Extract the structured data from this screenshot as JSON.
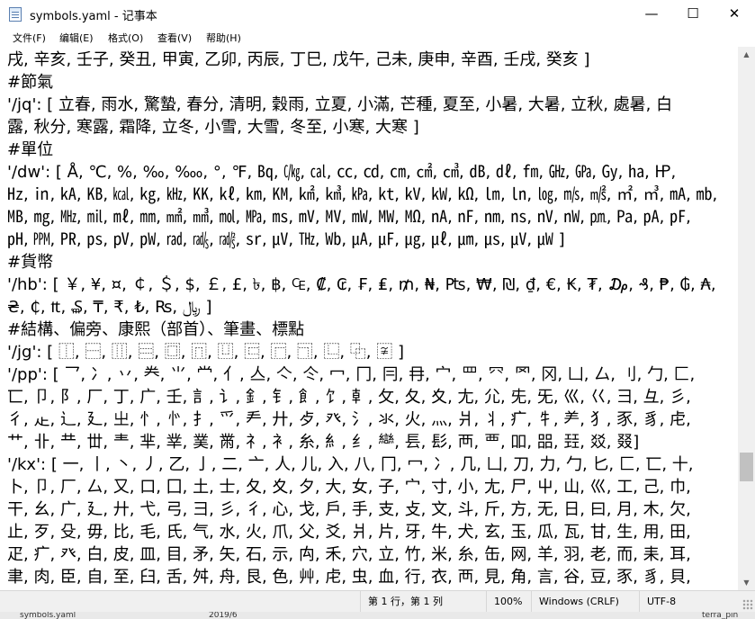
{
  "window": {
    "title": "symbols.yaml - 记事本",
    "minimize_glyph": "—",
    "maximize_glyph": "☐",
    "close_glyph": "✕",
    "icon": "notepad-icon"
  },
  "menu": {
    "items": [
      "文件(F)",
      "编辑(E)",
      "格式(O)",
      "查看(V)",
      "帮助(H)"
    ]
  },
  "editor": {
    "lines": [
      "戌, 辛亥, 壬子, 癸丑, 甲寅, 乙卯, 丙辰, 丁巳, 戊午, 己未, 庚申, 辛酉, 壬戌, 癸亥 ]",
      "#節氣",
      "   '/jq': [ 立春, 雨水, 驚蟄, 春分, 清明, 穀雨, 立夏, 小滿, 芒種, 夏至, 小暑, 大暑, 立秋, 處暑, 白",
      "露, 秋分, 寒露, 霜降, 立冬, 小雪, 大雪, 冬至, 小寒, 大寒 ]",
      "#單位",
      "   '/dw': [ Å, ℃, %, ‰, ‱, °, ℉, ㏃, ㏆, ㎈, ㏄, ㏅, ㎝, ㎠, ㎤, ㏈, ㎗, ㎙, ㎓, ㎬, ㏉, ㏊, ㏋,",
      "㎐, ㏌, ㎄, ㎅, ㎉, ㎏, ㎑, ㏍, ㎘, ㎞, ㏎, ㎢, ㎦, ㎪, ㏏, ㎸, ㎾, ㏀, ㏐, ㏑, ㏒, ㎧, ㎨, ㎡, ㎥, ㎃, ㏔,",
      "㎆, ㎎, ㎒, ㏕, ㎖, ㎜, ㎟, ㎣, ㏖, ㎫, ㎳, ㎷, ㎹, ㎽, ㎿, ㏁, ㎁, ㎋, ㎚, ㎱, ㎵, ㎻, ㏘, ㎩, ㎀, ㎊,",
      "㏗, ㏙, ㏚, ㎰, ㎴, ㎺, ㎭, ㎮, ㎯, ㏛, ㎶, ㎔, ㏝, ㎂, ㎌, ㎍, ㎕, ㎛, ㎲, ㎶, ㎼ ]",
      "#貨幣",
      "   '/hb': [ ￥, ¥, ¤, ￠, ＄, $, ￡, £, ৳, ฿, ₠, ₡, ₢, ₣, ₤, ₥, ₦, ₧, ₩, ₪, ₫, €, ₭, ₮, ₯, ₰, ₱, ₲, ₳,",
      "₴, ₵, ₶, ₷, ₸, ₹, ₺, ₨, ﷼ ]",
      "#結構、偏旁、康熙（部首）、筆畫、標點",
      "   '/jg': [ ⿰, ⿱, ⿲, ⿳, ⿴, ⿵, ⿶, ⿷, ⿸, ⿹, ⿺, ⿻, 〾 ]",
      "   '/pp': [ 乛, 冫, 丷, 龹, ⺌, 龸, 亻, 亼, 亽, 仒, 冖, 冂, 冃, 冄, 宀, 罒, 㓁, 罓, 冈, 凵, 厶, 刂, 勹, 匚,",
      "匸, 卩, 阝, 厂, 丁, 广, 壬, 訁, 讠, 釒, 钅, 飠, 饣, 龺, 攵, 夂, 夊, 尢, 尣, 兂, 旡, 巛, 巜, 彐, 彑, 彡,",
      "彳, 龰, 辶, 廴, 㞢, 忄, 㣺, 扌, 爫, 龵, 廾, 歺, 癶, 氵, 氺, 火, 灬, 爿, 丬, 疒, 牜, ⺶, 犭, 豕, 豸, 虍,",
      "艹, 卝, 龷, 丗, 龶, 芈, 丵, 菐, 黹, 礻, 衤, 糸, 糹, 纟, 龻, 镸, 髟, 襾, 覀, 吅, 㗊, 㠭, 㸚, 叕]",
      "   '/kx': [ 一, 丨, 丶, 丿, 乙, 亅, 二, 亠, 人, 儿, 入, 八, 冂, 冖, 冫, 几, 凵, 刀, 力, 勹, 匕, 匚, 匸, 十,",
      "卜, 卩, 厂, 厶, 又, 口, 囗, 土, 士, 夂, 夊, 夕, 大, 女, 子, 宀, 寸, 小, 尢, 尸, 屮, 山, 巛, 工, 己, 巾,",
      "干, 幺, 广, 廴, 廾, 弋, 弓, 彐, 彡, 彳, 心, 戈, 戶, 手, 支, 攴, 文, 斗, 斤, 方, 无, 日, 曰, 月, 木, 欠,",
      "止, 歹, 殳, 毋, 比, 毛, 氏, 气, 水, 火, 爪, 父, 爻, 爿, 片, 牙, 牛, 犬, 玄, 玉, 瓜, 瓦, 甘, 生, 用, 田,",
      "疋, 疒, 癶, 白, 皮, 皿, 目, 矛, 矢, 石, 示, 禸, 禾, 穴, 立, 竹, 米, 糸, 缶, 网, 羊, 羽, 老, 而, 耒, 耳,",
      "聿, 肉, 臣, 自, 至, 臼, 舌, 舛, 舟, 艮, 色, 艸, 虍, 虫, 血, 行, 衣, 襾, 見, 角, 言, 谷, 豆, 豕, 豸, 貝,"
    ]
  },
  "status": {
    "position": "第 1 行，第 1 列",
    "zoom": "100%",
    "line_ending": "Windows (CRLF)",
    "encoding": "UTF-8"
  },
  "taskbar": {
    "items": [
      "symbols.yaml",
      "2019/6",
      "terra_pin"
    ]
  }
}
